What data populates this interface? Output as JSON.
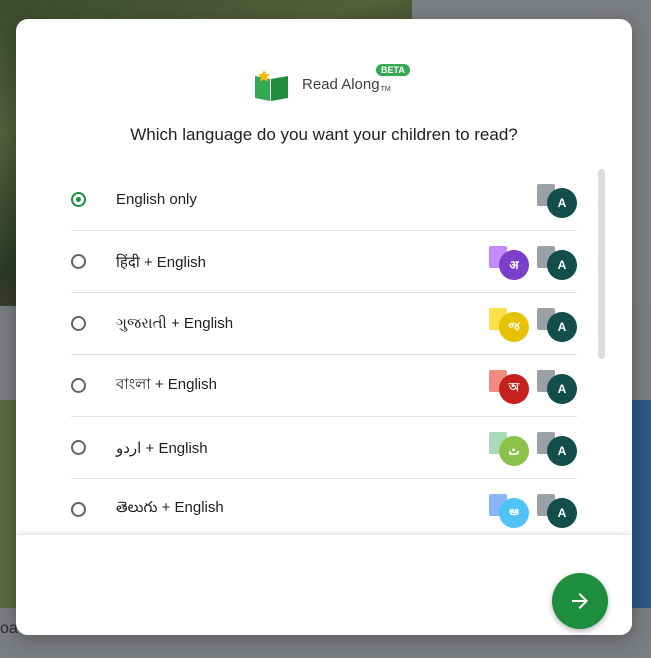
{
  "background": {
    "partial_text": "oa"
  },
  "dialog": {
    "logo_text": "Read Along",
    "logo_tm": "TM",
    "beta_badge": "BETA",
    "question": "Which language do you want your children to read?",
    "next_icon": "arrow-right-icon",
    "options": [
      {
        "label": "English only",
        "selected": true,
        "icons": [
          {
            "glyph": "A",
            "book": "#9aa0a6",
            "circle": "#134e4a"
          }
        ]
      },
      {
        "label": "हिंदी + English",
        "selected": false,
        "icons": [
          {
            "glyph": "अ",
            "book": "#c58af9",
            "circle": "#7b3fc9"
          },
          {
            "glyph": "A",
            "book": "#9aa0a6",
            "circle": "#134e4a"
          }
        ]
      },
      {
        "label": "ગુજરાતી + English",
        "selected": false,
        "icons": [
          {
            "glyph": "જ",
            "book": "#fde047",
            "circle": "#e6c200"
          },
          {
            "glyph": "A",
            "book": "#9aa0a6",
            "circle": "#134e4a"
          }
        ]
      },
      {
        "label": "বাংলা + English",
        "selected": false,
        "icons": [
          {
            "glyph": "অ",
            "book": "#f28b82",
            "circle": "#c5221f"
          },
          {
            "glyph": "A",
            "book": "#9aa0a6",
            "circle": "#134e4a"
          }
        ]
      },
      {
        "label": "اردو + English",
        "selected": false,
        "icons": [
          {
            "glyph": "ٹ",
            "book": "#a8dab5",
            "circle": "#8bc34a"
          },
          {
            "glyph": "A",
            "book": "#9aa0a6",
            "circle": "#134e4a"
          }
        ]
      },
      {
        "label": "తెలుగు + English",
        "selected": false,
        "icons": [
          {
            "glyph": "ఆ",
            "book": "#8ab4f8",
            "circle": "#4fc3f7"
          },
          {
            "glyph": "A",
            "book": "#9aa0a6",
            "circle": "#134e4a"
          }
        ]
      },
      {
        "label": "",
        "selected": false,
        "icons": []
      }
    ]
  }
}
